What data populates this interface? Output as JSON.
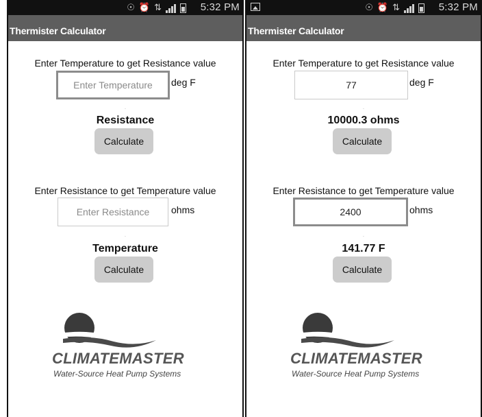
{
  "status_bar": {
    "time": "5:32 PM",
    "icons": [
      "picture-icon",
      "eye-icon",
      "alarm-icon",
      "network-icon",
      "signal-icon",
      "battery-icon"
    ]
  },
  "colors": {
    "status_bar": "#111111",
    "title_bar": "#5e5e5e",
    "button": "#cccccc"
  },
  "screens": [
    {
      "title": "Thermister Calculator",
      "temp_prompt": "Enter Temperature to get Resistance value",
      "temp_value": "",
      "temp_placeholder": "Enter Temperature",
      "temp_unit": "deg F",
      "dot": ".",
      "resistance_result": "Resistance",
      "calc_label": "Calculate",
      "res_prompt": "Enter Resistance to get Temperature value",
      "res_value": "",
      "res_placeholder": "Enter Resistance",
      "res_unit": "ohms",
      "temperature_result": "Temperature",
      "logo": {
        "name": "CLIMATEMASTER",
        "tagline": "Water-Source Heat Pump Systems"
      }
    },
    {
      "title": "Thermister Calculator",
      "temp_prompt": "Enter Temperature to get Resistance value",
      "temp_value": "77",
      "temp_placeholder": "",
      "temp_unit": "deg F",
      "dot": ".",
      "resistance_result": "10000.3 ohms",
      "calc_label": "Calculate",
      "res_prompt": "Enter Resistance to get Temperature value",
      "res_value": "2400",
      "res_placeholder": "",
      "res_unit": "ohms",
      "temperature_result": "141.77 F",
      "logo": {
        "name": "CLIMATEMASTER",
        "tagline": "Water-Source Heat Pump Systems"
      }
    }
  ]
}
